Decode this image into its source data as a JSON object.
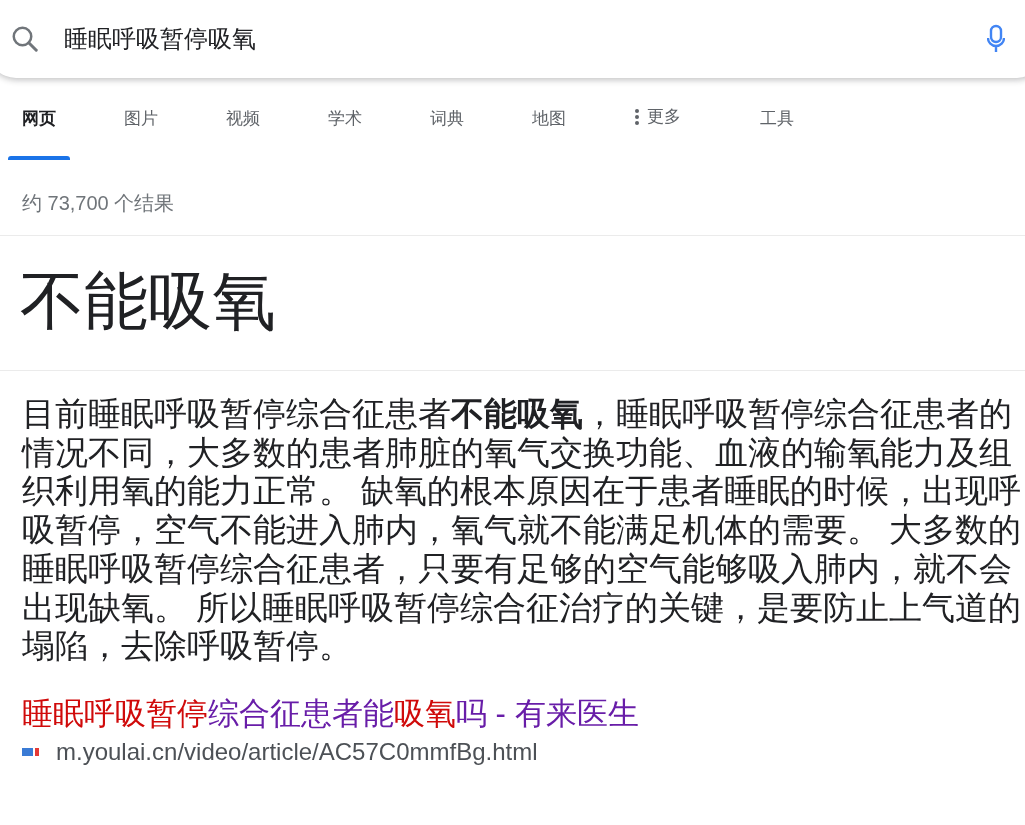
{
  "search": {
    "value": "睡眠呼吸暂停吸氧"
  },
  "tabs": [
    {
      "label": "网页",
      "selected": true
    },
    {
      "label": "图片",
      "selected": false
    },
    {
      "label": "视频",
      "selected": false
    },
    {
      "label": "学术",
      "selected": false
    },
    {
      "label": "词典",
      "selected": false
    },
    {
      "label": "地图",
      "selected": false
    },
    {
      "label": "更多",
      "selected": false,
      "kind": "menu"
    },
    {
      "label": "工具",
      "selected": false
    }
  ],
  "result_count": "约 73,700 个结果",
  "answer": {
    "heading": "不能吸氧",
    "text": "目前睡眠呼吸暂停综合征患者**不能吸氧**，睡眠呼吸暂停综合征患者的情况不同，大多数的患者肺脏的氧气交换功能、血液的输氧能力及组织利用氧的能力正常。 缺氧的根本原因在于患者睡眠的时候，出现呼吸暂停，空气不能进入肺内，氧气就不能满足机体的需要。 大多数的睡眠呼吸暂停综合征患者，只要有足够的空气能够吸入肺内，就不会出现缺氧。 所以睡眠呼吸暂停综合征治疗的关键，是要防止上气道的塌陷，去除呼吸暂停。"
  },
  "source": {
    "title_parts": [
      {
        "text": "睡眠呼吸暂停",
        "match": true
      },
      {
        "text": "综合征患者能",
        "match": false
      },
      {
        "text": "吸氧",
        "match": true
      },
      {
        "text": "吗 - 有来医生",
        "match": false
      }
    ],
    "url": "m.youlai.cn/video/article/AC57C0mmfBg.html"
  }
}
